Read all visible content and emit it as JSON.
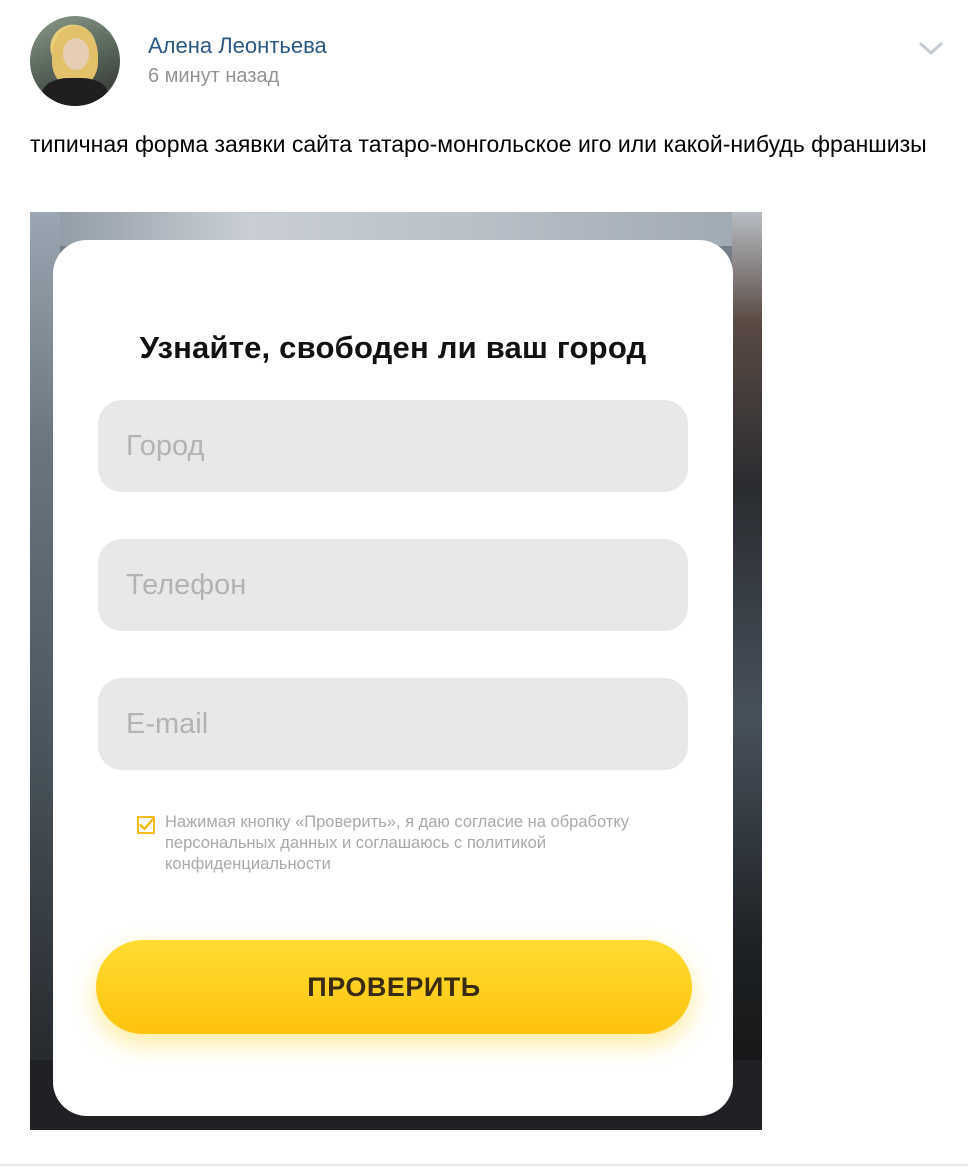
{
  "post": {
    "author_name": "Алена Леонтьева",
    "time": "6 минут назад",
    "text": "типичная форма заявки сайта татаро-монгольское иго или какой-нибудь франшизы",
    "menu_icon": "chevron-down-icon",
    "avatar_icon": "avatar"
  },
  "form": {
    "title": "Узнайте, свободен ли ваш город",
    "city_placeholder": "Город",
    "phone_placeholder": "Телефон",
    "email_placeholder": "E-mail",
    "consent_checked": true,
    "consent_text": "Нажимая кнопку «Проверить», я даю согласие на обработку персональных данных и соглашаюсь с политикой конфиденциальности",
    "submit_label": "ПРОВЕРИТЬ"
  },
  "colors": {
    "author_link": "#2a5885",
    "muted": "#939393",
    "button_yellow": "#ffc20e",
    "field_bg": "#e8e8e8"
  }
}
